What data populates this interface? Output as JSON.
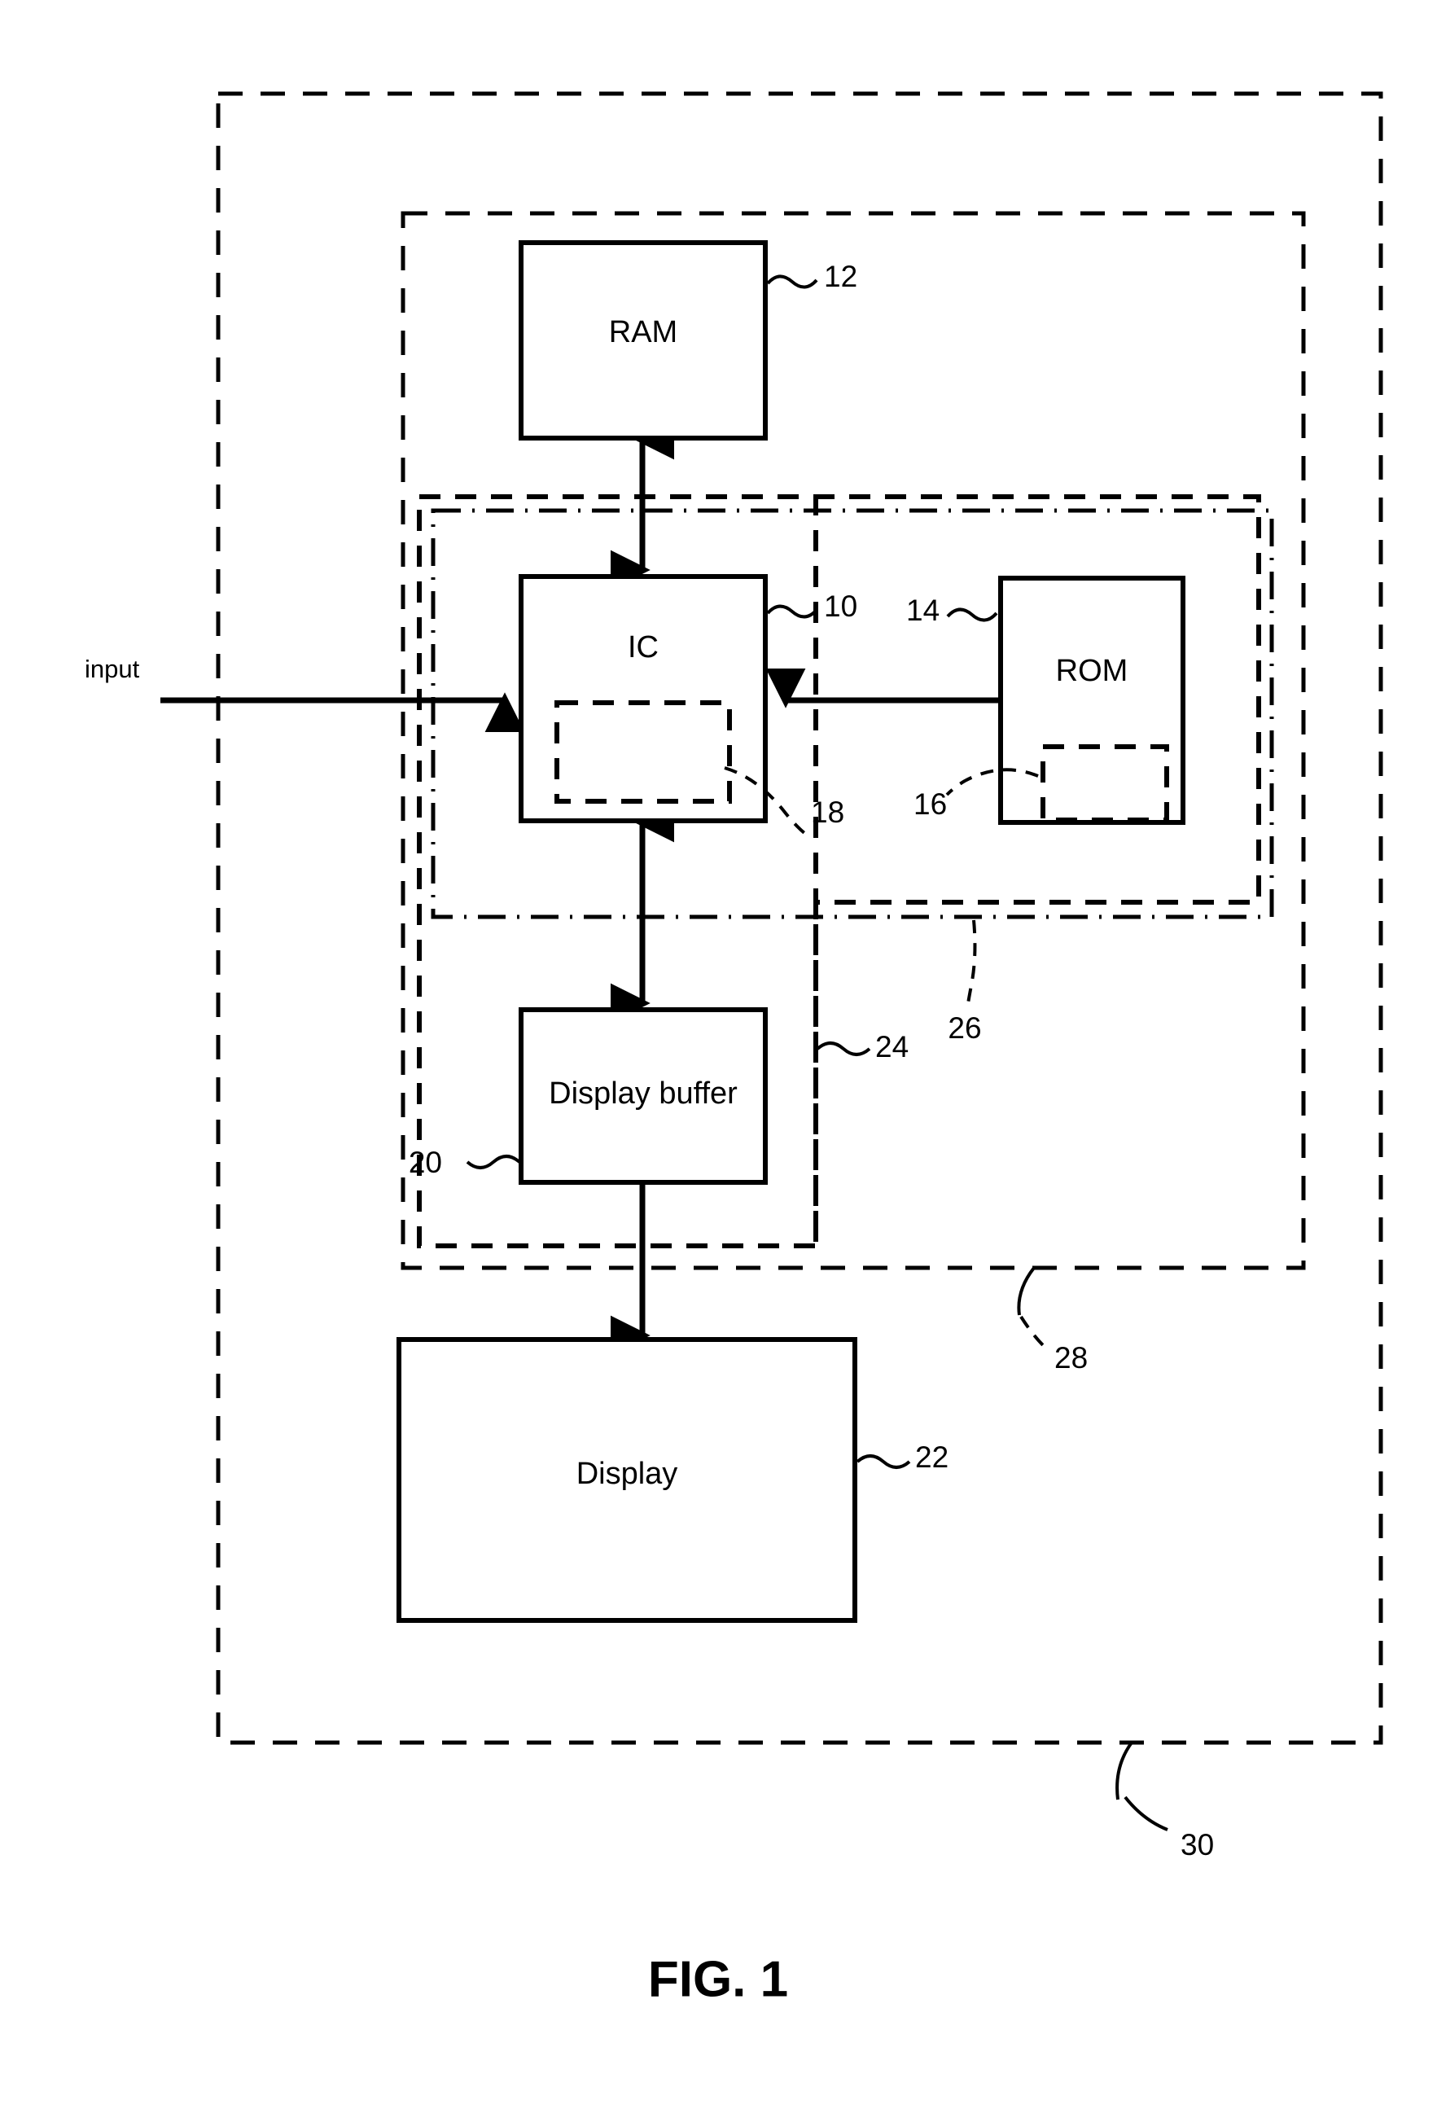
{
  "figure": {
    "caption": "FIG. 1",
    "input_label": "input"
  },
  "blocks": [
    {
      "id": "ram",
      "label": "RAM",
      "ref": "12"
    },
    {
      "id": "ic",
      "label": "IC",
      "ref": "10"
    },
    {
      "id": "rom",
      "label": "ROM",
      "ref": "14"
    },
    {
      "id": "display_buffer",
      "label": "Display buffer",
      "ref": "20"
    },
    {
      "id": "display",
      "label": "Display",
      "ref": "22"
    }
  ],
  "inner_regions": [
    {
      "id": "ic_inner",
      "parent": "ic",
      "ref": "18"
    },
    {
      "id": "rom_inner",
      "parent": "rom",
      "ref": "16"
    }
  ],
  "boundaries": [
    {
      "id": "boundary_24",
      "ref": "24",
      "style": "dashed",
      "desc": "inner dashed boundary enclosing RAM, IC and display buffer"
    },
    {
      "id": "boundary_26",
      "ref": "26",
      "style": "dash-dot",
      "desc": "dash-dot boundary enclosing IC and ROM"
    },
    {
      "id": "boundary_28",
      "ref": "28",
      "style": "dashed",
      "desc": "dashed boundary enclosing memory subsystem"
    },
    {
      "id": "boundary_30",
      "ref": "30",
      "style": "dashed",
      "desc": "outermost dashed device boundary"
    }
  ],
  "reference_numerals": {
    "n10": "10",
    "n12": "12",
    "n14": "14",
    "n16": "16",
    "n18": "18",
    "n20": "20",
    "n22": "22",
    "n24": "24",
    "n26": "26",
    "n28": "28",
    "n30": "30"
  },
  "colors": {
    "stroke": "#000000",
    "background": "#ffffff"
  }
}
